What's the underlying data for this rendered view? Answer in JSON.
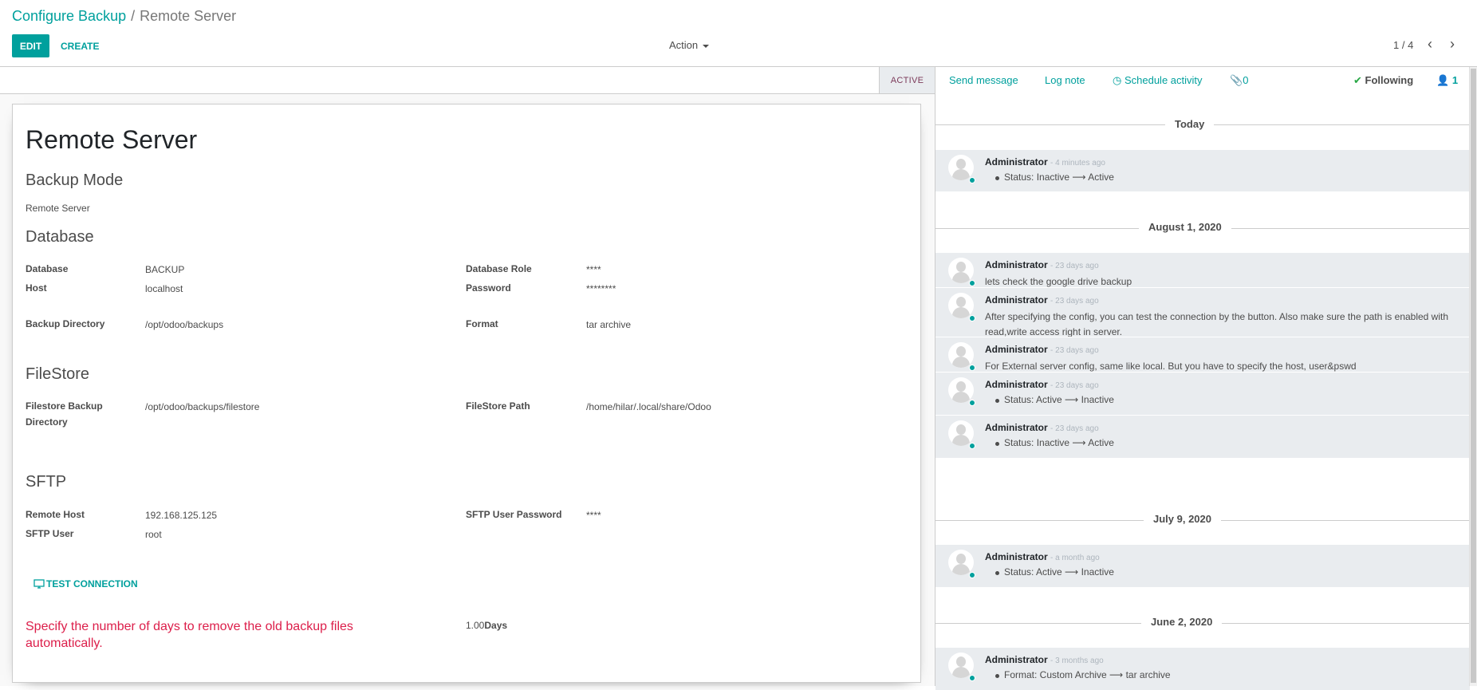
{
  "breadcrumb": {
    "parent": "Configure Backup",
    "separator": "/",
    "current": "Remote Server"
  },
  "toolbar": {
    "edit_label": "EDIT",
    "create_label": "CREATE",
    "action_label": "Action"
  },
  "pager": {
    "value": "1 / 4",
    "prev_icon": "chevron-left-icon",
    "next_icon": "chevron-right-icon"
  },
  "statusbar": {
    "state_label": "ACTIVE"
  },
  "form": {
    "title": "Remote Server",
    "sections": {
      "backup_mode": {
        "heading": "Backup Mode",
        "value": "Remote Server"
      },
      "database": {
        "heading": "Database",
        "database_label": "Database",
        "database_value": "BACKUP",
        "host_label": "Host",
        "host_value": "localhost",
        "role_label": "Database Role",
        "role_value": "****",
        "password_label": "Password",
        "password_value": "********",
        "directory_label": "Backup Directory",
        "directory_value": "/opt/odoo/backups",
        "format_label": "Format",
        "format_value": "tar archive"
      },
      "filestore": {
        "heading": "FileStore",
        "dir_label": "Filestore Backup Directory",
        "dir_value": "/opt/odoo/backups/filestore",
        "path_label": "FileStore Path",
        "path_value": "/home/hilar/.local/share/Odoo"
      },
      "sftp": {
        "heading": "SFTP",
        "host_label": "Remote Host",
        "host_value": "192.168.125.125",
        "user_label": "SFTP User",
        "user_value": "root",
        "password_label": "SFTP User Password",
        "password_value": "****"
      }
    },
    "test_button": "TEST CONNECTION",
    "warning": "Specify the number of days to remove the old backup files automatically.",
    "days_value": "1.00",
    "days_unit": "Days"
  },
  "chatter": {
    "send_message": "Send message",
    "log_note": "Log note",
    "schedule_activity": "Schedule activity",
    "attachments": "0",
    "following": "Following",
    "followers": "1",
    "groups": [
      {
        "date": "Today",
        "messages": [
          {
            "author": "Administrator",
            "time": "- 4 minutes ago",
            "kind": "track",
            "text": "Status: Inactive ⟶ Active"
          }
        ]
      },
      {
        "date": "August 1, 2020",
        "messages": [
          {
            "author": "Administrator",
            "time": "- 23 days ago",
            "kind": "body",
            "text": "lets check the google drive backup"
          },
          {
            "author": "Administrator",
            "time": "- 23 days ago",
            "kind": "body",
            "text": "After specifying the config, you can test the connection by the button. Also make sure the path is enabled with read,write access right in server."
          },
          {
            "author": "Administrator",
            "time": "- 23 days ago",
            "kind": "body",
            "text": "For External server config, same like local. But you have to specify the host, user&pswd"
          },
          {
            "author": "Administrator",
            "time": "- 23 days ago",
            "kind": "track",
            "text": "Status: Active ⟶ Inactive"
          },
          {
            "author": "Administrator",
            "time": "- 23 days ago",
            "kind": "track",
            "text": "Status: Inactive ⟶ Active"
          }
        ]
      },
      {
        "date": "July 9, 2020",
        "messages": [
          {
            "author": "Administrator",
            "time": "- a month ago",
            "kind": "track",
            "text": "Status: Active ⟶ Inactive"
          }
        ]
      },
      {
        "date": "June 2, 2020",
        "messages": [
          {
            "author": "Administrator",
            "time": "- 3 months ago",
            "kind": "track",
            "text": "Format: Custom Archive ⟶ tar archive"
          }
        ]
      }
    ]
  },
  "colors": {
    "primary": "#00a09d",
    "warning_text": "#dc1e4a",
    "message_bg": "#e9ecef"
  }
}
